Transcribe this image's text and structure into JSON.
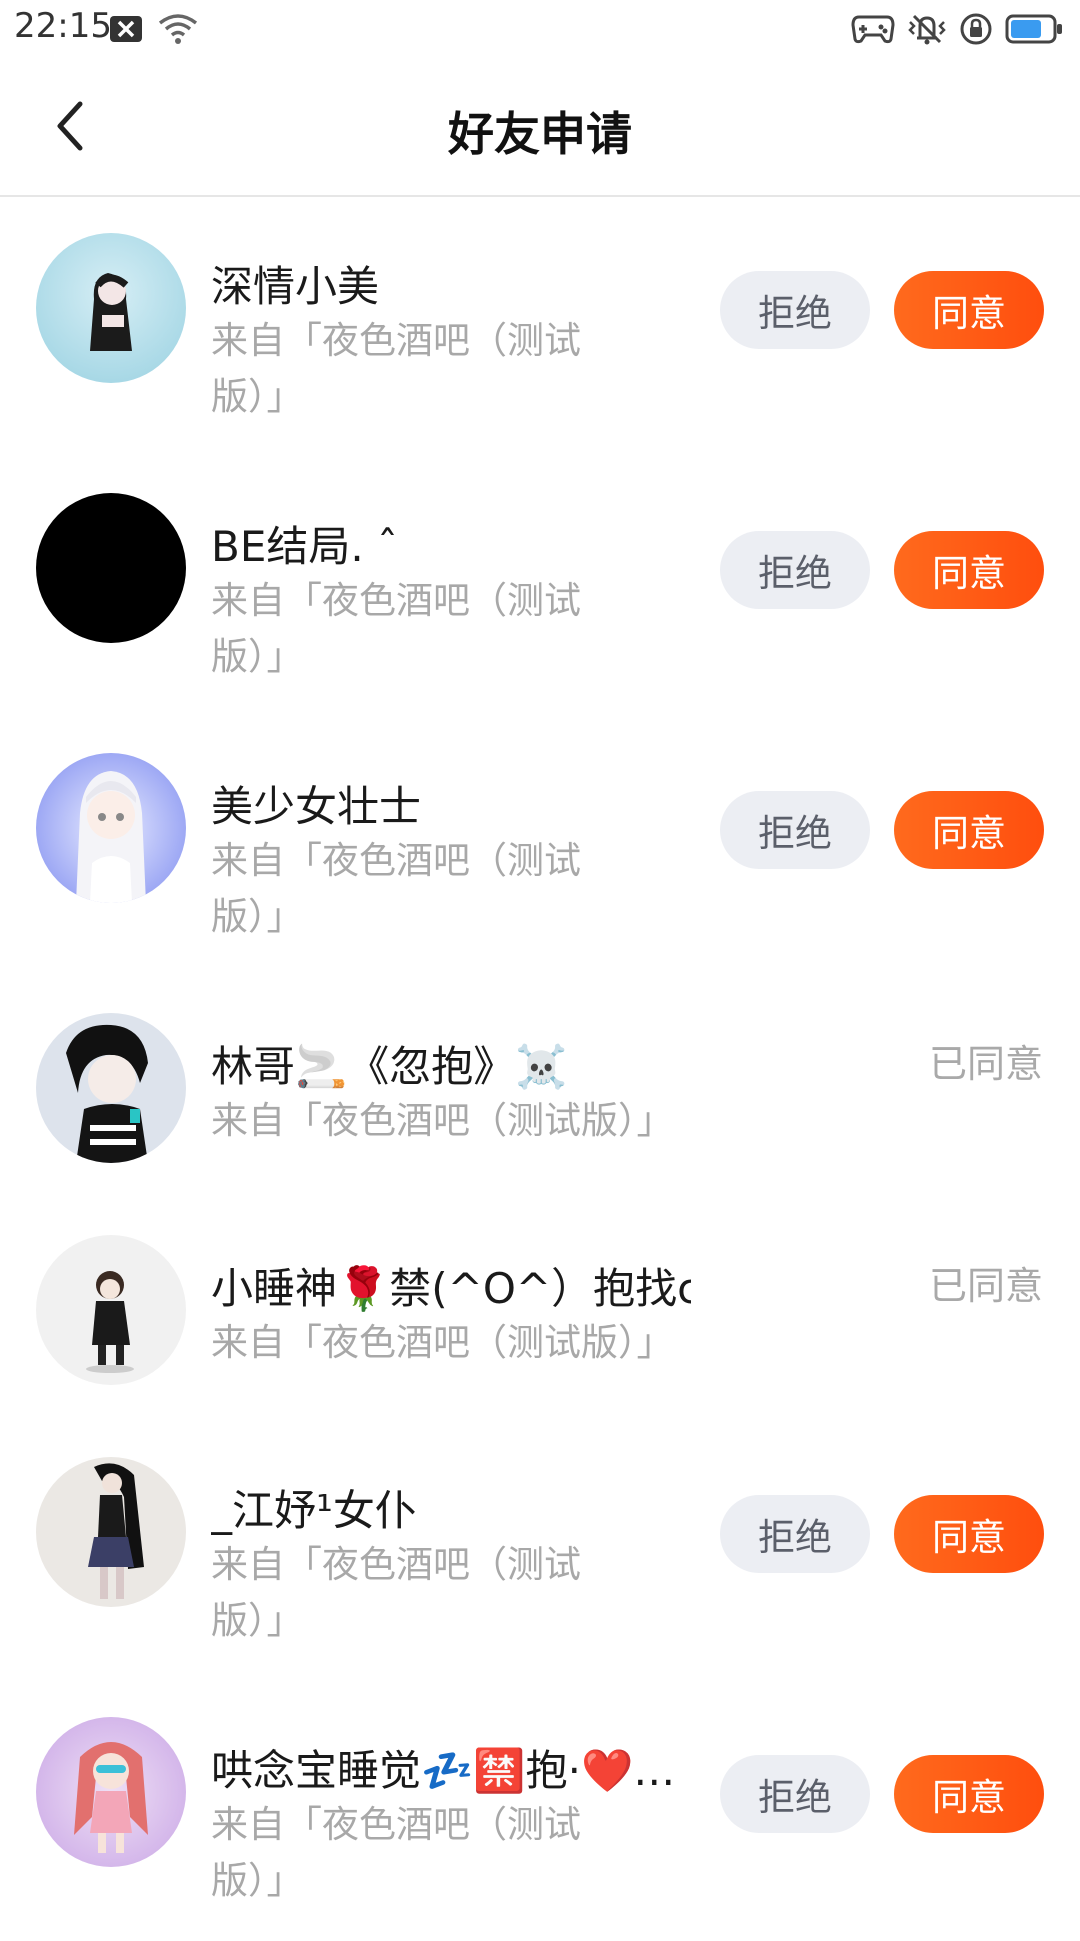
{
  "status_bar": {
    "time": "22:15",
    "icons": [
      "notification-x-icon",
      "wifi-icon",
      "gamepad-icon",
      "vibrate-icon",
      "lock-rotation-icon",
      "battery-icon"
    ],
    "battery_color": "#3a9bf0"
  },
  "header": {
    "title": "好友申请",
    "back_icon": "chevron-left-icon"
  },
  "labels": {
    "reject": "拒绝",
    "accept": "同意",
    "agreed": "已同意"
  },
  "colors": {
    "accent": "#ff5a14",
    "reject_bg": "#eceef3",
    "secondary_text": "#a8a8a8"
  },
  "requests": [
    {
      "name": "深情小美",
      "source": "来自「夜色酒吧（测试版）」",
      "status": "pending"
    },
    {
      "name": "BE结局. ˆ",
      "source": "来自「夜色酒吧（测试版）」",
      "status": "pending"
    },
    {
      "name": "美少女壮士",
      "source": "来自「夜色酒吧（测试版）」",
      "status": "pending"
    },
    {
      "name": "林哥🚬《忽抱》☠️",
      "source": "来自「夜色酒吧（测试版）」",
      "status": "agreed"
    },
    {
      "name": "小睡神🌹禁(^O^）抱找cp。",
      "source": "来自「夜色酒吧（测试版）」",
      "status": "agreed"
    },
    {
      "name": "_江妤¹女仆",
      "source": "来自「夜色酒吧（测试版）」",
      "status": "pending"
    },
    {
      "name": "哄念宝睡觉💤🈲抱·❤️…",
      "source": "来自「夜色酒吧（测试版）」",
      "status": "pending"
    }
  ]
}
